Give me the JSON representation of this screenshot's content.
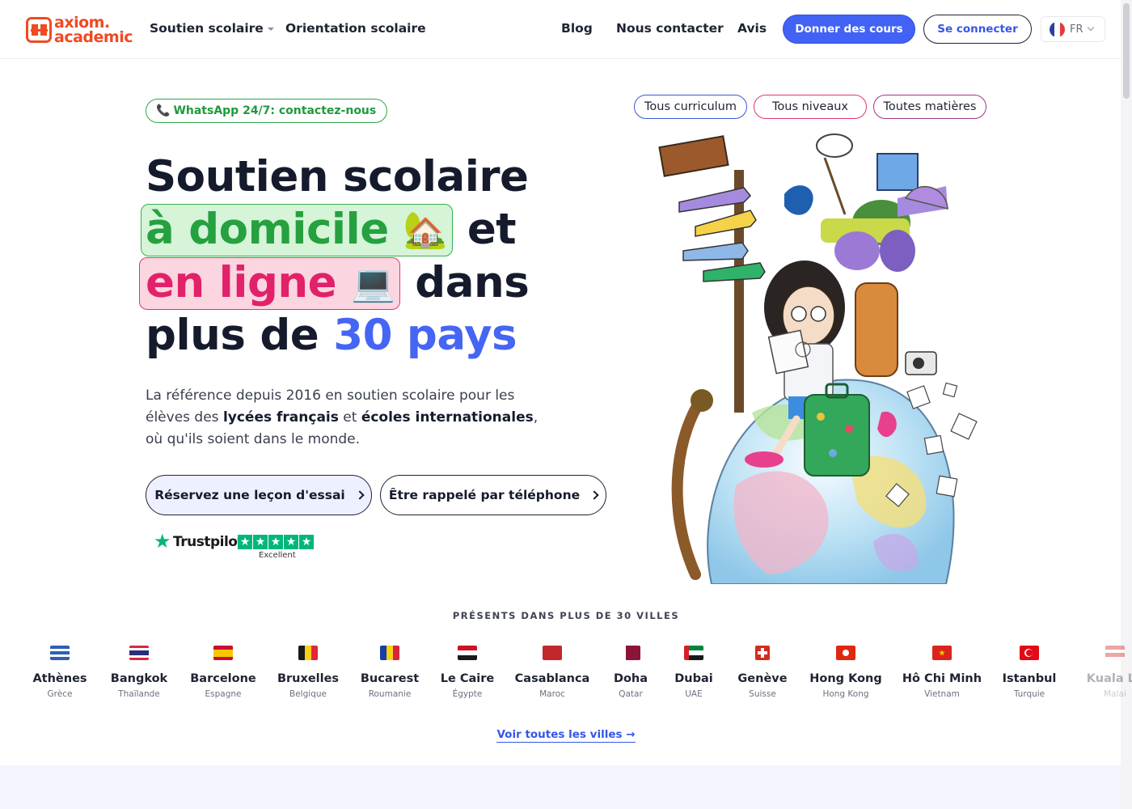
{
  "header": {
    "logo_line1": "axiom.",
    "logo_line2": "academic",
    "nav": {
      "soutien": "Soutien scolaire",
      "orientation": "Orientation scolaire",
      "blog": "Blog",
      "contact": "Nous contacter",
      "avis": "Avis"
    },
    "give_lessons": "Donner des cours",
    "login": "Se connecter",
    "language": "FR"
  },
  "hero": {
    "whatsapp_badge": "WhatsApp 24/7: contactez-nous",
    "title_line1": "Soutien scolaire",
    "title_hl1": "à domicile",
    "title_emoji1": "🏡",
    "title_after1": "et",
    "title_hl2": "en ligne",
    "title_emoji2": "💻",
    "title_after2": "dans",
    "title_line4_a": "plus de",
    "title_line4_b": "30 pays",
    "lead_part1": "La référence depuis 2016 en soutien scolaire pour les élèves des",
    "lead_bold1": "lycées français",
    "lead_part2": "et",
    "lead_bold2": "écoles internationales",
    "lead_part3": ", où qu'ils soient dans le monde.",
    "cta_trial": "Réservez une leçon d'essai",
    "cta_callback": "Être rappelé par téléphone",
    "trustpilot_name": "Trustpilot",
    "trustpilot_rating": "Excellent"
  },
  "filters": {
    "curriculum": "Tous curriculum",
    "levels": "Tous niveaux",
    "subjects": "Toutes matières"
  },
  "cities_section": {
    "title": "PRÉSENTS DANS PLUS DE 30 VILLES",
    "see_all": "Voir toutes les villes →",
    "cities": [
      {
        "name": "Athènes",
        "country": "Grèce"
      },
      {
        "name": "Bangkok",
        "country": "Thaïlande"
      },
      {
        "name": "Barcelone",
        "country": "Espagne"
      },
      {
        "name": "Bruxelles",
        "country": "Belgique"
      },
      {
        "name": "Bucarest",
        "country": "Roumanie"
      },
      {
        "name": "Le Caire",
        "country": "Égypte"
      },
      {
        "name": "Casablanca",
        "country": "Maroc"
      },
      {
        "name": "Doha",
        "country": "Qatar"
      },
      {
        "name": "Dubai",
        "country": "UAE"
      },
      {
        "name": "Genève",
        "country": "Suisse"
      },
      {
        "name": "Hong Kong",
        "country": "Hong Kong"
      },
      {
        "name": "Hô Chi Minh",
        "country": "Vietnam"
      },
      {
        "name": "Istanbul",
        "country": "Turquie"
      },
      {
        "name": "Kuala Lu",
        "country": "Malai"
      }
    ]
  },
  "colors": {
    "brand_orange": "#ef4a23",
    "primary_blue": "#4262f5",
    "highlight_green": "#25a13f",
    "highlight_pink": "#e1216a"
  }
}
